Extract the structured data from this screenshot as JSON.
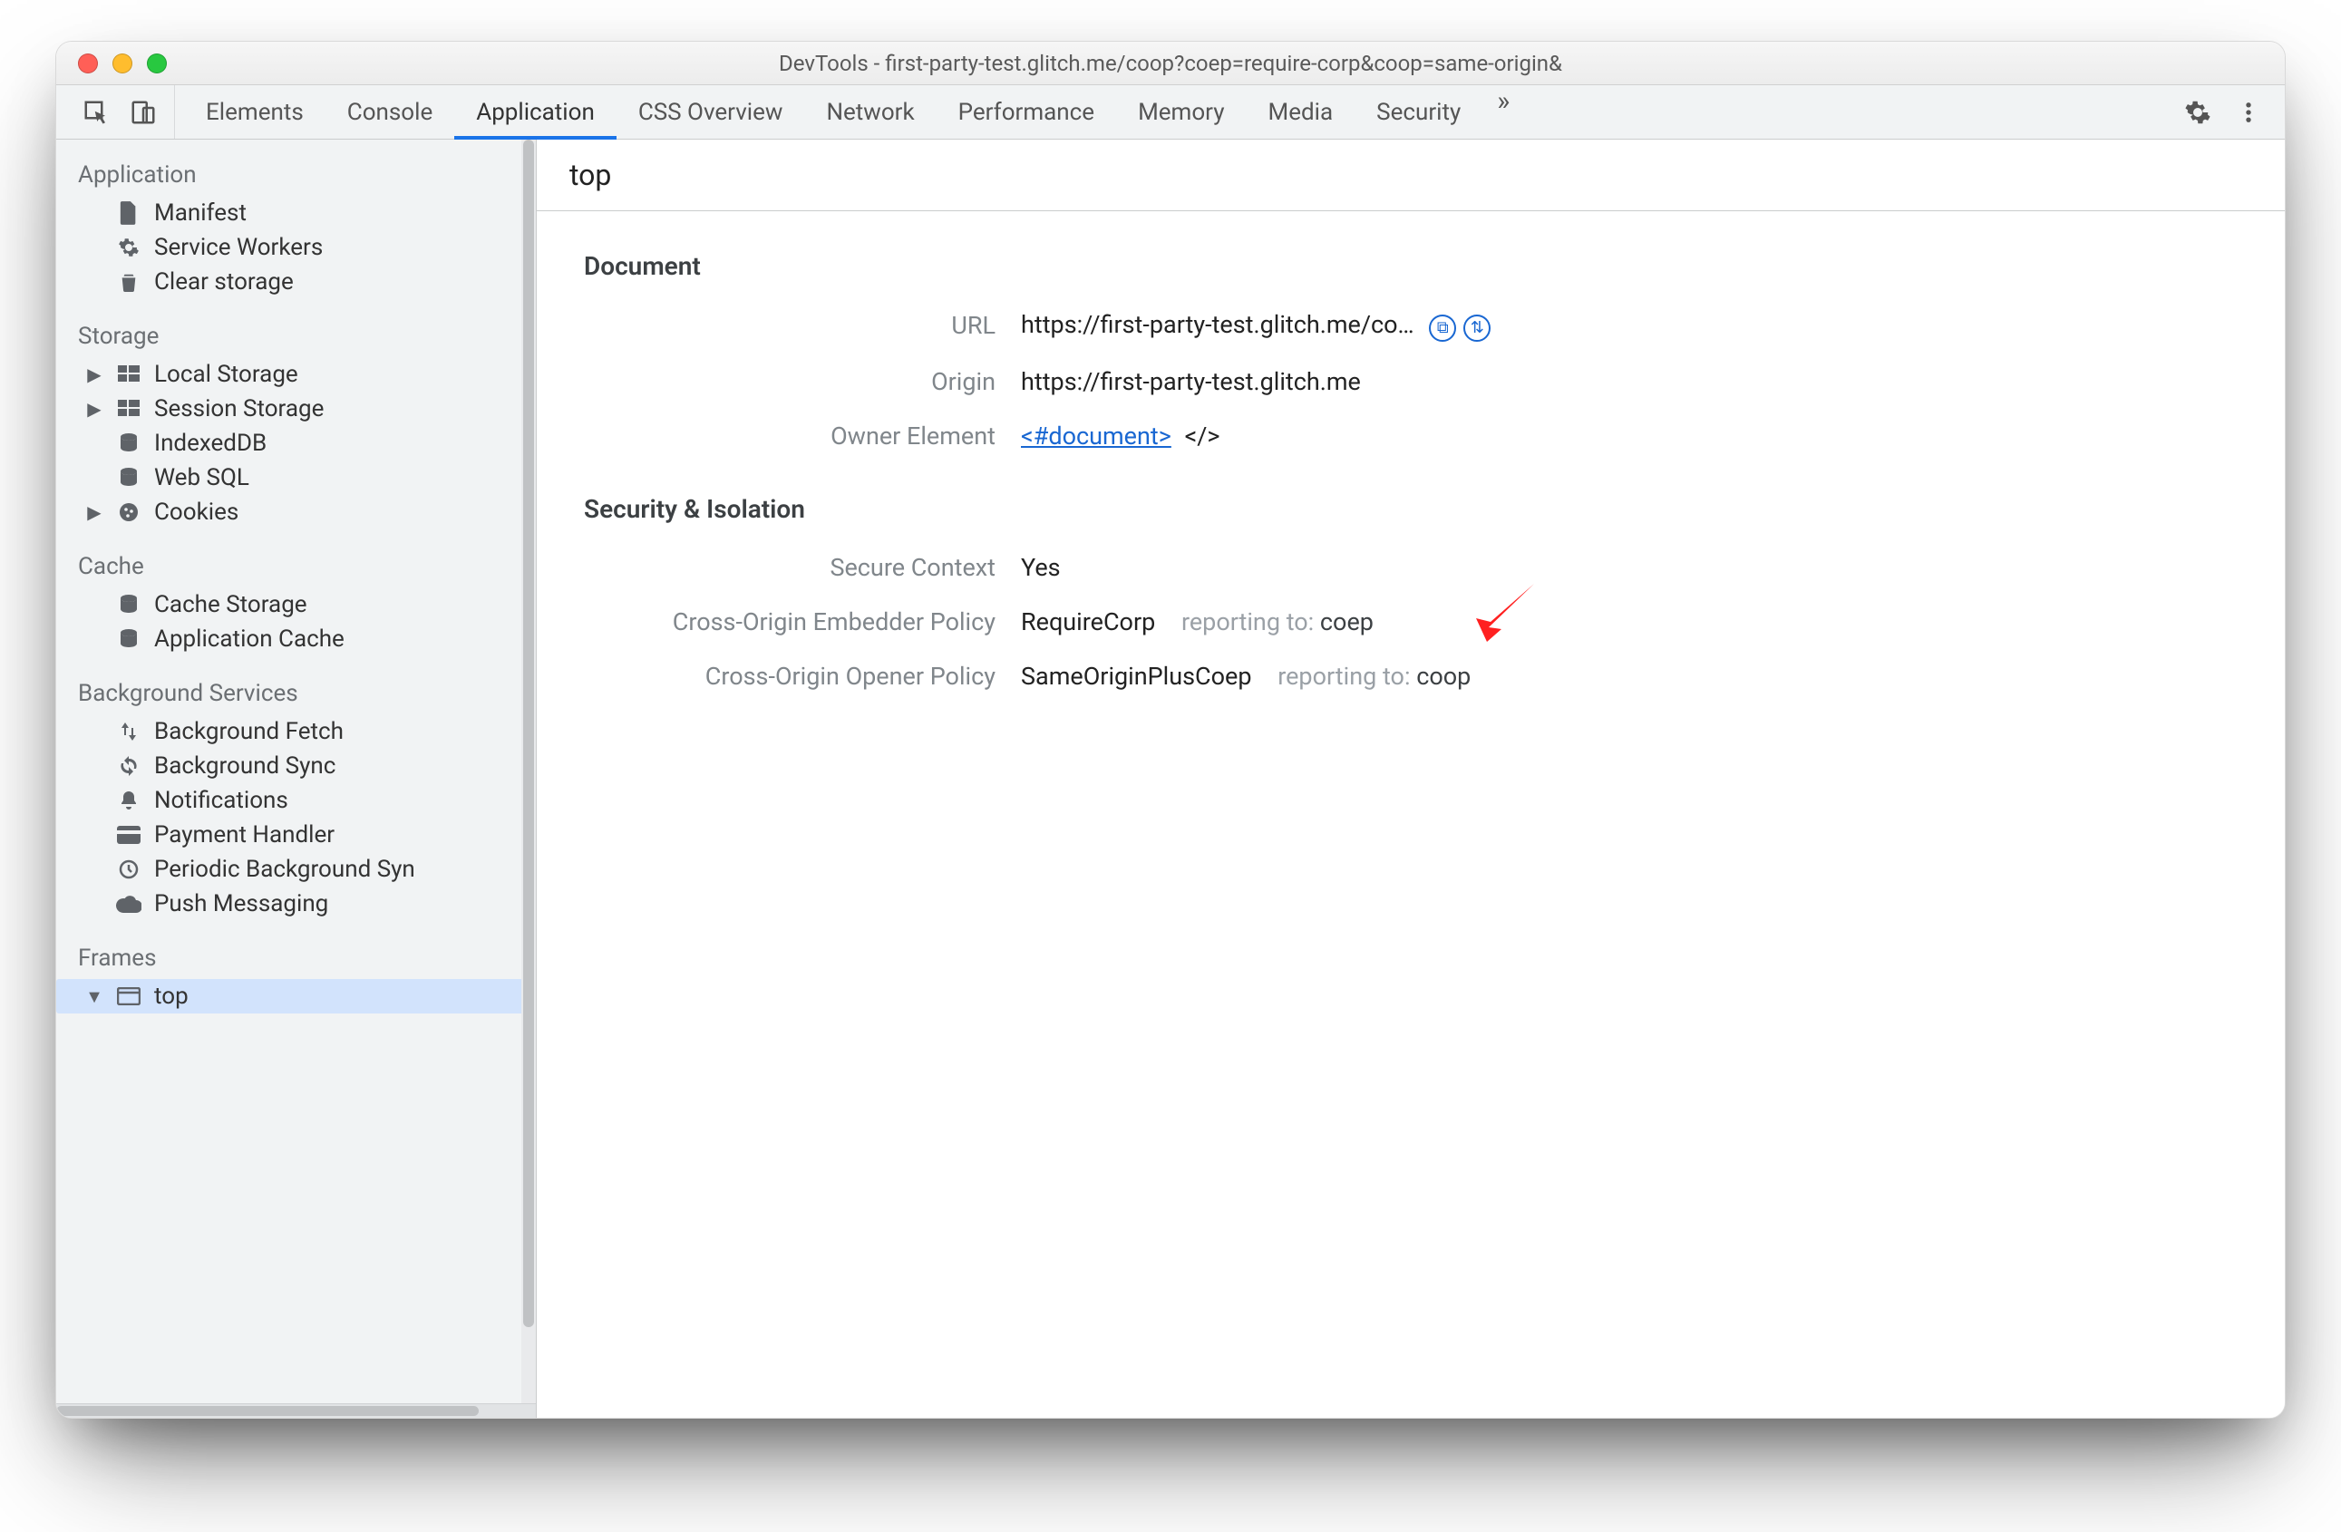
{
  "window": {
    "title": "DevTools - first-party-test.glitch.me/coop?coep=require-corp&coop=same-origin&"
  },
  "tabs": {
    "items": [
      {
        "label": "Elements"
      },
      {
        "label": "Console"
      },
      {
        "label": "Application",
        "active": true
      },
      {
        "label": "CSS Overview"
      },
      {
        "label": "Network"
      },
      {
        "label": "Performance"
      },
      {
        "label": "Memory"
      },
      {
        "label": "Media"
      },
      {
        "label": "Security"
      }
    ]
  },
  "sidebar": {
    "groups": [
      {
        "title": "Application",
        "items": [
          {
            "icon": "file",
            "label": "Manifest"
          },
          {
            "icon": "gear",
            "label": "Service Workers"
          },
          {
            "icon": "trash",
            "label": "Clear storage"
          }
        ]
      },
      {
        "title": "Storage",
        "items": [
          {
            "expandable": true,
            "icon": "grid",
            "label": "Local Storage"
          },
          {
            "expandable": true,
            "icon": "grid",
            "label": "Session Storage"
          },
          {
            "icon": "db",
            "label": "IndexedDB"
          },
          {
            "icon": "db",
            "label": "Web SQL"
          },
          {
            "expandable": true,
            "icon": "cookies",
            "label": "Cookies"
          }
        ]
      },
      {
        "title": "Cache",
        "items": [
          {
            "icon": "db",
            "label": "Cache Storage"
          },
          {
            "icon": "db",
            "label": "Application Cache"
          }
        ]
      },
      {
        "title": "Background Services",
        "items": [
          {
            "icon": "updown",
            "label": "Background Fetch"
          },
          {
            "icon": "sync",
            "label": "Background Sync"
          },
          {
            "icon": "bell",
            "label": "Notifications"
          },
          {
            "icon": "card",
            "label": "Payment Handler"
          },
          {
            "icon": "clock",
            "label": "Periodic Background Syn"
          },
          {
            "icon": "cloud",
            "label": "Push Messaging"
          }
        ]
      },
      {
        "title": "Frames",
        "items": [
          {
            "expandable": true,
            "expanded": true,
            "icon": "frame",
            "label": "top",
            "selected": true
          }
        ]
      }
    ]
  },
  "main": {
    "frame_title": "top",
    "document": {
      "section_title": "Document",
      "url_label": "URL",
      "url_value": "https://first-party-test.glitch.me/co…",
      "origin_label": "Origin",
      "origin_value": "https://first-party-test.glitch.me",
      "owner_label": "Owner Element",
      "owner_value": "<#document>"
    },
    "security": {
      "section_title": "Security & Isolation",
      "secure_label": "Secure Context",
      "secure_value": "Yes",
      "coep_label": "Cross-Origin Embedder Policy",
      "coep_value": "RequireCorp",
      "coep_rep_label": "reporting to:",
      "coep_rep_value": "coep",
      "coop_label": "Cross-Origin Opener Policy",
      "coop_value": "SameOriginPlusCoep",
      "coop_rep_label": "reporting to:",
      "coop_rep_value": "coop"
    }
  }
}
